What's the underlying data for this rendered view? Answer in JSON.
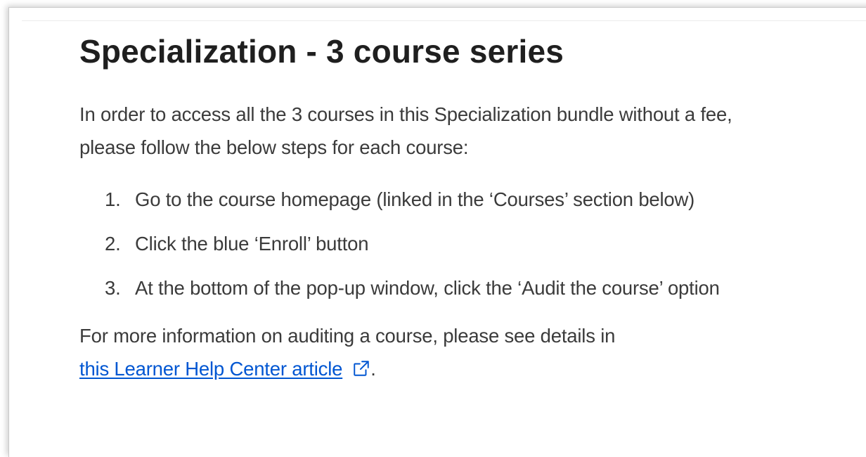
{
  "title": "Specialization - 3 course series",
  "intro_line1": "In order to access all the 3 courses in this Specialization bundle without a fee,",
  "intro_line2": "please follow the below steps for each course:",
  "steps": [
    {
      "number": "1.",
      "text": "Go to the course homepage (linked in the ‘Courses’ section below)"
    },
    {
      "number": "2.",
      "text": "Click the blue ‘Enroll’ button"
    },
    {
      "number": "3.",
      "text": "At the bottom of the pop-up window, click the ‘Audit the course’ option"
    }
  ],
  "footer_text": "For more information on auditing a course, please see details in",
  "link_text": "this Learner Help Center article",
  "link_suffix": ".",
  "icons": {
    "external_link": "external-link-icon"
  },
  "colors": {
    "link": "#0056d2",
    "text": "#3b3b3b",
    "title": "#1f1f1f"
  }
}
